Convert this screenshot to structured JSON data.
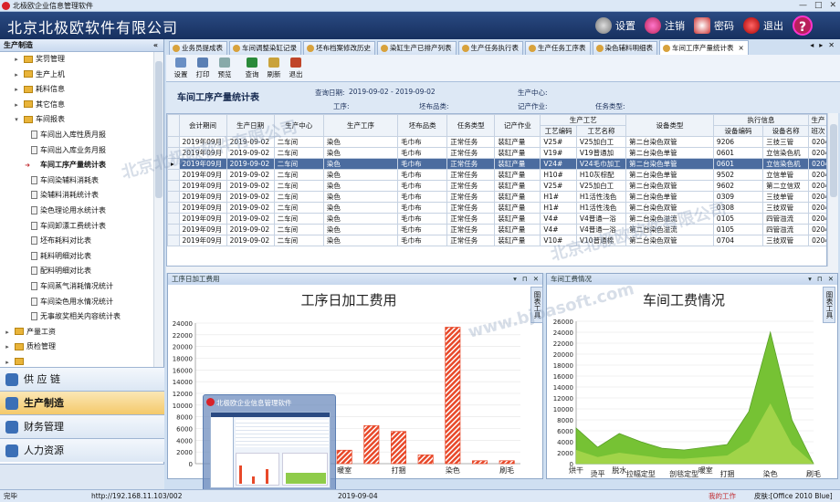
{
  "window": {
    "title": "北极欧企业信息管理软件"
  },
  "header": {
    "app_title": "北京北极欧软件有限公司",
    "buttons": [
      {
        "label": "设置",
        "icon": "gear-icon"
      },
      {
        "label": "注销",
        "icon": "lock-icon"
      },
      {
        "label": "密码",
        "icon": "key-icon"
      },
      {
        "label": "退出",
        "icon": "power-icon"
      }
    ],
    "help_label": "?"
  },
  "sidebar": {
    "section_title": "生产制造",
    "tree": [
      {
        "label": "奖罚管理",
        "type": "folder",
        "level": 1,
        "arrow": "▸"
      },
      {
        "label": "生产上机",
        "type": "folder",
        "level": 1,
        "arrow": "▸"
      },
      {
        "label": "耗料信息",
        "type": "folder",
        "level": 1,
        "arrow": "▸"
      },
      {
        "label": "其它信息",
        "type": "folder",
        "level": 1,
        "arrow": "▸"
      },
      {
        "label": "车间报表",
        "type": "folder",
        "level": 1,
        "arrow": "▾"
      },
      {
        "label": "车间出入库性质月报",
        "type": "doc",
        "level": 2
      },
      {
        "label": "车间出入库业务月报",
        "type": "doc",
        "level": 2
      },
      {
        "label": "车间工序产量统计表",
        "type": "doc",
        "level": 2,
        "selected": true
      },
      {
        "label": "车间染辅料消耗表",
        "type": "doc",
        "level": 2
      },
      {
        "label": "染辅料消耗统计表",
        "type": "doc",
        "level": 2
      },
      {
        "label": "染色理论用水统计表",
        "type": "doc",
        "level": 2
      },
      {
        "label": "车间卸漂工费统计表",
        "type": "doc",
        "level": 2
      },
      {
        "label": "坯布耗料对比表",
        "type": "doc",
        "level": 2
      },
      {
        "label": "耗料明细对比表",
        "type": "doc",
        "level": 2
      },
      {
        "label": "配料明细对比表",
        "type": "doc",
        "level": 2
      },
      {
        "label": "车间蒸气消耗情况统计",
        "type": "doc",
        "level": 2
      },
      {
        "label": "车间染色用水情况统计",
        "type": "doc",
        "level": 2
      },
      {
        "label": "无事故奖相关内容统计表",
        "type": "doc",
        "level": 2
      },
      {
        "label": "产量工资",
        "type": "folder",
        "level": 0,
        "arrow": "▸"
      },
      {
        "label": "质检管理",
        "type": "folder",
        "level": 0,
        "arrow": "▸"
      },
      {
        "label": "",
        "type": "folder",
        "level": 0,
        "arrow": "▸"
      }
    ],
    "nav": [
      {
        "label": "供 应 链",
        "active": false
      },
      {
        "label": "生产制造",
        "active": true
      },
      {
        "label": "财务管理",
        "active": false
      },
      {
        "label": "人力资源",
        "active": false
      }
    ]
  },
  "tabs": [
    {
      "label": "业务员提成表"
    },
    {
      "label": "车间调整染缸记录"
    },
    {
      "label": "坯布档案修改历史"
    },
    {
      "label": "染缸生产已排产列表"
    },
    {
      "label": "生产任务执行表"
    },
    {
      "label": "生产任务工序表"
    },
    {
      "label": "染色辅料明细表"
    },
    {
      "label": "车间工序产量统计表",
      "active": true,
      "close": "×"
    }
  ],
  "toolbar": [
    {
      "label": "设置",
      "icon": "settings-icon"
    },
    {
      "label": "打印",
      "icon": "print-icon"
    },
    {
      "label": "预览",
      "icon": "preview-icon"
    },
    {
      "label": "查询",
      "icon": "binoculars-icon"
    },
    {
      "label": "刷新",
      "icon": "refresh-icon"
    },
    {
      "label": "退出",
      "icon": "exit-icon"
    }
  ],
  "report": {
    "title": "车间工序产量统计表",
    "query_date_label": "查询日期:",
    "query_date_value": "2019-09-02 - 2019-09-02",
    "workshop_label": "生产中心:",
    "process_label": "工序:",
    "fabric_label": "坯布品类:",
    "job_label": "记产作业:",
    "task_type_label": "任务类型:"
  },
  "table": {
    "group_headers": {
      "process": "生产工艺",
      "exec": "执行信息",
      "prod": "生产"
    },
    "columns": [
      "会计期间",
      "生产日期",
      "生产中心",
      "生产工序",
      "坯布品类",
      "任务类型",
      "记产作业",
      "工艺编码",
      "工艺名称",
      "设备类型",
      "设备编码",
      "设备名称",
      "班次"
    ],
    "rows": [
      [
        "2019年09月",
        "2019-09-02",
        "二车间",
        "染色",
        "毛巾布",
        "正常任务",
        "装缸产量",
        "V25#",
        "V25加白工",
        "第二台染色双管",
        "9206",
        "三技三管",
        "0204"
      ],
      [
        "2019年09月",
        "2019-09-02",
        "二车间",
        "染色",
        "毛巾布",
        "正常任务",
        "装缸产量",
        "V19#",
        "V19普通加",
        "第二台染色单管",
        "0601",
        "立信染色机",
        "0204"
      ],
      [
        "2019年09月",
        "2019-09-02",
        "二车间",
        "染色",
        "毛巾布",
        "正常任务",
        "装缸产量",
        "V24#",
        "V24毛巾加工",
        "第二台染色单管",
        "0601",
        "立信染色机",
        "0204"
      ],
      [
        "2019年09月",
        "2019-09-02",
        "二车间",
        "染色",
        "毛巾布",
        "正常任务",
        "装缸产量",
        "H10#",
        "H10灰棕配",
        "第二台染色单管",
        "9502",
        "立信单管",
        "0204"
      ],
      [
        "2019年09月",
        "2019-09-02",
        "二车间",
        "染色",
        "毛巾布",
        "正常任务",
        "装缸产量",
        "V25#",
        "V25加白工",
        "第二台染色双管",
        "9602",
        "第二立信双",
        "0204"
      ],
      [
        "2019年09月",
        "2019-09-02",
        "二车间",
        "染色",
        "毛巾布",
        "正常任务",
        "装缸产量",
        "H1#",
        "H1活性浅色",
        "第二台染色单管",
        "0309",
        "三技单管",
        "0204"
      ],
      [
        "2019年09月",
        "2019-09-02",
        "二车间",
        "染色",
        "毛巾布",
        "正常任务",
        "装缸产量",
        "H1#",
        "H1活性浅色",
        "第二台染色双管",
        "0308",
        "三技双管",
        "0204"
      ],
      [
        "2019年09月",
        "2019-09-02",
        "二车间",
        "染色",
        "毛巾布",
        "正常任务",
        "装缸产量",
        "V4#",
        "V4普通一浴",
        "第二台染色溢流",
        "0105",
        "四管溢流",
        "0204"
      ],
      [
        "2019年09月",
        "2019-09-02",
        "二车间",
        "染色",
        "毛巾布",
        "正常任务",
        "装缸产量",
        "V4#",
        "V4普通一浴",
        "第二台染色溢流",
        "0105",
        "四管溢流",
        "0204"
      ],
      [
        "2019年09月",
        "2019-09-02",
        "二车间",
        "染色",
        "毛巾布",
        "正常任务",
        "装缸产量",
        "V10#",
        "V10普通棉",
        "第二台染色双管",
        "0704",
        "三技双管",
        "0204"
      ]
    ],
    "selected_row": 2
  },
  "chart_panels": [
    {
      "panel_label": "工序日加工费用",
      "side_tab": "图表工具",
      "title": "工序日加工费用"
    },
    {
      "panel_label": "车间工费情况",
      "side_tab": "图表工具",
      "title": "车间工费情况"
    }
  ],
  "chart_data": [
    {
      "type": "bar",
      "title": "工序日加工费用",
      "categories": [
        "",
        "",
        "",
        "剖毯定型",
        "",
        "暖室",
        "",
        "打捆",
        "",
        "染色",
        "",
        "刷毛"
      ],
      "values": [
        0,
        0,
        0,
        2500,
        3300,
        2300,
        6500,
        5500,
        1500,
        23300,
        500,
        500
      ],
      "ylim": [
        0,
        24000
      ],
      "yticks": [
        0,
        2000,
        4000,
        6000,
        8000,
        10000,
        12000,
        14000,
        16000,
        18000,
        20000,
        22000,
        24000
      ],
      "colors": [
        "#e8492a"
      ]
    },
    {
      "type": "area",
      "title": "车间工费情况",
      "categories": [
        "烘干",
        "烫平",
        "脱水",
        "拉幅定型",
        "",
        "剖毯定型",
        "暖室",
        "打捆",
        "",
        "染色",
        "",
        "刷毛"
      ],
      "series": [
        {
          "values": [
            6500,
            3000,
            5500,
            4000,
            2800,
            2500,
            3000,
            3500,
            9500,
            24000,
            8000,
            0
          ],
          "color": "#6fbf2a"
        },
        {
          "values": [
            2500,
            1200,
            2000,
            1500,
            1000,
            900,
            1200,
            1500,
            4000,
            11000,
            3500,
            0
          ],
          "color": "#a6d64b"
        }
      ],
      "ylim": [
        0,
        26000
      ],
      "yticks": [
        0,
        2000,
        4000,
        6000,
        8000,
        10000,
        12000,
        14000,
        16000,
        18000,
        20000,
        22000,
        24000,
        26000
      ]
    }
  ],
  "statusbar": {
    "left": "完毕",
    "url": "http://192.168.11.103/002",
    "date": "2019-09-04",
    "my_work": "我的工作",
    "skin": "皮肤:[Office 2010 Blue]"
  },
  "preview": {
    "title": "北极欧企业信息管理软件"
  },
  "watermarks": [
    "北京北极欧软件有限公司",
    "www.bjoasoft.com"
  ]
}
